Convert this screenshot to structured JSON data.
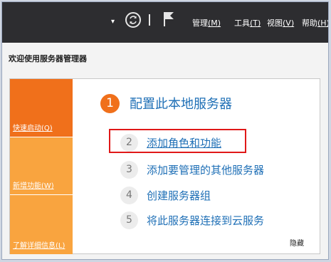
{
  "toolbar": {
    "dropdown_icon": "▾",
    "menus": [
      {
        "label": "管理",
        "key": "(M)"
      },
      {
        "label": "工具",
        "key": "(T)"
      },
      {
        "label": "视图",
        "key": "(V)"
      },
      {
        "label": "帮助",
        "key": "(H)"
      }
    ]
  },
  "heading": "欢迎使用服务器管理器",
  "tabs": [
    {
      "label": "快速启动(Q)",
      "color": "#f0701b"
    },
    {
      "label": "新增功能(W)",
      "color": "#f9a43f"
    },
    {
      "label": "了解详细信息(L)",
      "color": "#f9a43f"
    }
  ],
  "main": {
    "number": "1",
    "title": "配置此本地服务器",
    "steps": [
      {
        "number": "2",
        "label": "添加角色和功能"
      },
      {
        "number": "3",
        "label": "添加要管理的其他服务器"
      },
      {
        "number": "4",
        "label": "创建服务器组"
      },
      {
        "number": "5",
        "label": "将此服务器连接到云服务"
      }
    ],
    "hide_label": "隐藏"
  },
  "colors": {
    "accent": "#f0701b",
    "link": "#1e6fb6",
    "highlight": "#e01818",
    "topbar": "#2d2d30"
  }
}
